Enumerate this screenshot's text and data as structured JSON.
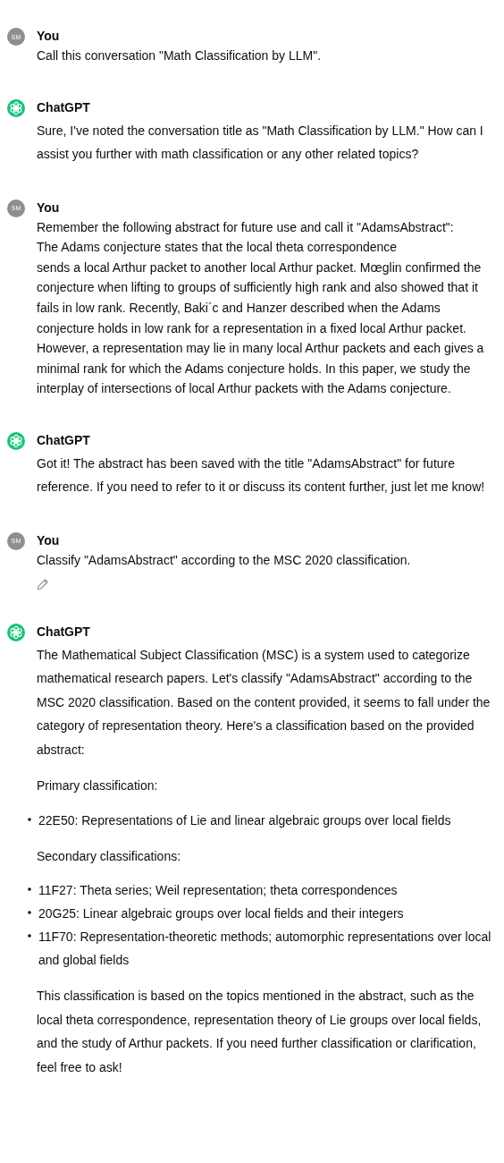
{
  "messages": [
    {
      "kind": "user",
      "author": "You",
      "avatar": "SM",
      "editable": false,
      "blocks": [
        {
          "kind": "paragraph",
          "text": "Call this conversation \"Math Classification by LLM\"."
        }
      ]
    },
    {
      "kind": "assistant",
      "author": "ChatGPT",
      "blocks": [
        {
          "kind": "paragraph",
          "text": "Sure, I've noted the conversation title as \"Math Classification by LLM.\" How can I assist you further with math classification or any other related topics?"
        }
      ]
    },
    {
      "kind": "user",
      "author": "You",
      "avatar": "SM",
      "editable": false,
      "blocks": [
        {
          "kind": "paragraph",
          "text": "Remember the following abstract for future use and call it \"AdamsAbstract\":\nThe Adams conjecture states that the local theta correspondence\nsends a local Arthur packet to another local Arthur packet. Mœglin confirmed the conjecture when lifting to groups of sufficiently high rank and also showed that it fails in low rank. Recently, Baki´c and Hanzer described when the Adams conjecture holds in low rank for a representation in a fixed local Arthur packet. However, a representation may lie in many local Arthur packets and each gives a minimal rank for which the Adams conjecture holds. In this paper, we study the interplay of intersections of local Arthur packets with the Adams conjecture."
        }
      ]
    },
    {
      "kind": "assistant",
      "author": "ChatGPT",
      "blocks": [
        {
          "kind": "paragraph",
          "text": "Got it! The abstract has been saved with the title \"AdamsAbstract\" for future reference. If you need to refer to it or discuss its content further, just let me know!"
        }
      ]
    },
    {
      "kind": "user",
      "author": "You",
      "avatar": "SM",
      "editable": true,
      "blocks": [
        {
          "kind": "paragraph",
          "text": "Classify \"AdamsAbstract\" according to the MSC 2020 classification."
        }
      ]
    },
    {
      "kind": "assistant",
      "author": "ChatGPT",
      "blocks": [
        {
          "kind": "paragraph",
          "text": "The Mathematical Subject Classification (MSC) is a system used to categorize mathematical research papers. Let's classify \"AdamsAbstract\" according to the MSC 2020 classification. Based on the content provided, it seems to fall under the category of representation theory. Here's a classification based on the provided abstract:"
        },
        {
          "kind": "paragraph",
          "text": "Primary classification:"
        },
        {
          "kind": "list",
          "items": [
            "22E50: Representations of Lie and linear algebraic groups over local fields"
          ]
        },
        {
          "kind": "paragraph",
          "text": "Secondary classifications:"
        },
        {
          "kind": "list",
          "items": [
            "11F27: Theta series; Weil representation; theta correspondences",
            "20G25: Linear algebraic groups over local fields and their integers",
            "11F70: Representation-theoretic methods; automorphic representations over local and global fields"
          ]
        },
        {
          "kind": "paragraph",
          "text": "This classification is based on the topics mentioned in the abstract, such as the local theta correspondence, representation theory of Lie groups over local fields, and the study of Arthur packets. If you need further classification or clarification, feel free to ask!"
        }
      ]
    }
  ]
}
